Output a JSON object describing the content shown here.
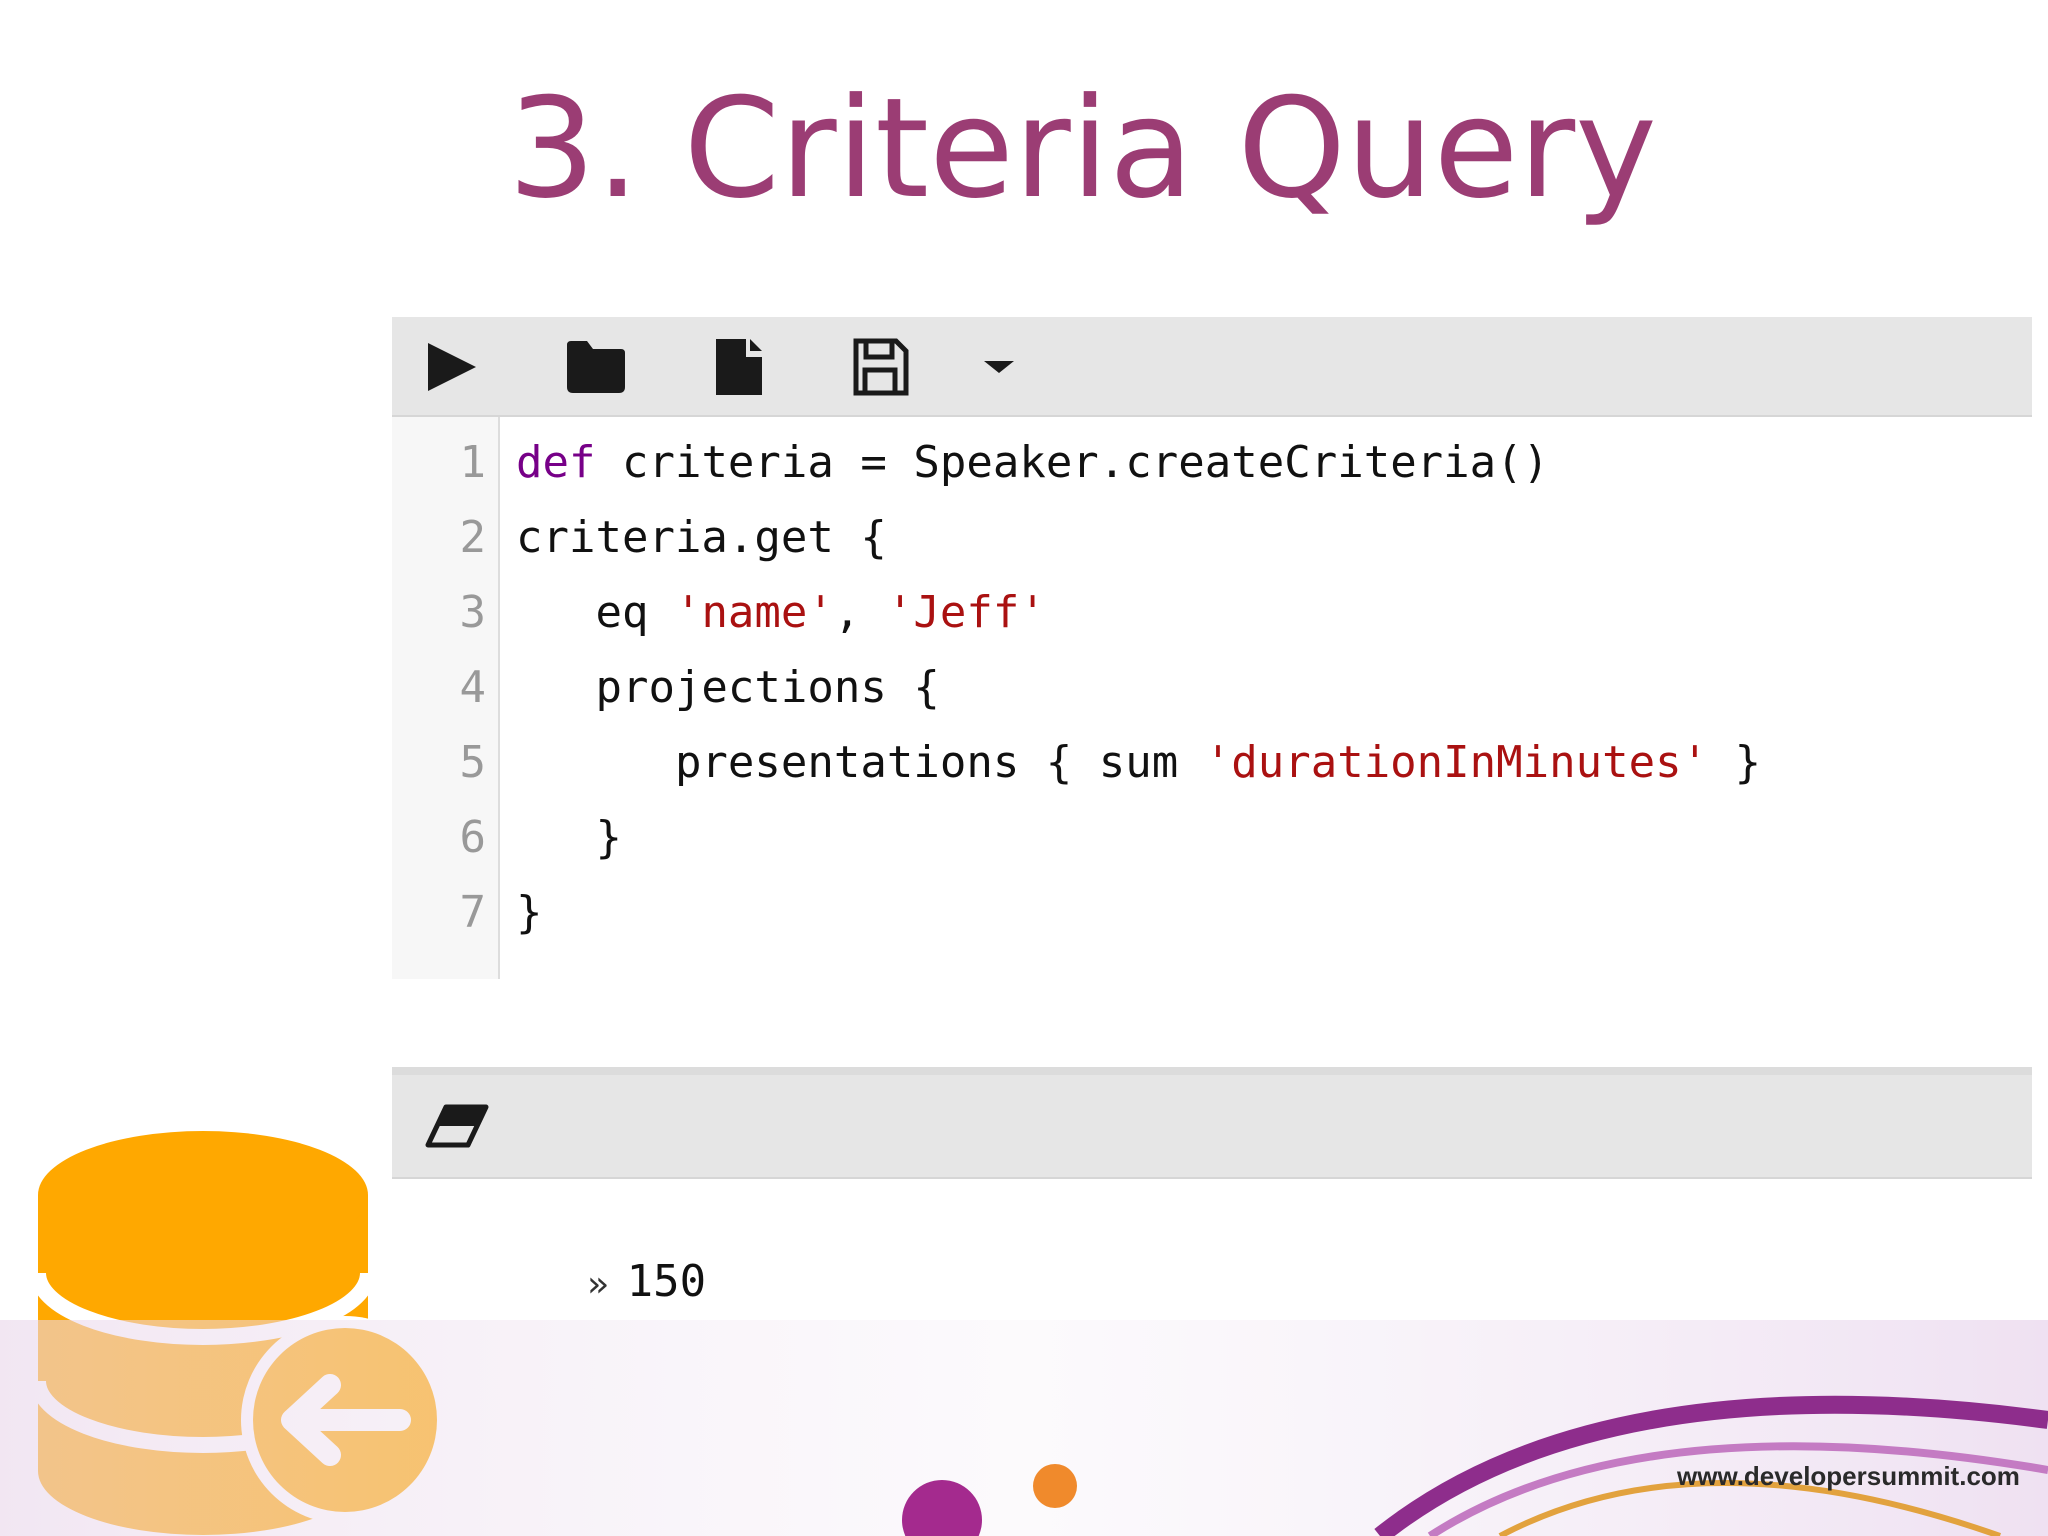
{
  "slide": {
    "title": "3. Criteria Query",
    "footer_url": "www.developersummit.com"
  },
  "toolbar": {
    "buttons": [
      {
        "name": "run-icon"
      },
      {
        "name": "folder-icon"
      },
      {
        "name": "file-icon"
      },
      {
        "name": "save-icon"
      },
      {
        "name": "dropdown-caret-icon"
      }
    ]
  },
  "editor": {
    "line_numbers": [
      "1",
      "2",
      "3",
      "4",
      "5",
      "6",
      "7"
    ],
    "lines": [
      [
        {
          "t": "def",
          "c": "kw"
        },
        {
          "t": " criteria = Speaker.createCriteria()",
          "c": ""
        }
      ],
      [
        {
          "t": "criteria.get {",
          "c": ""
        }
      ],
      [
        {
          "t": "   eq ",
          "c": ""
        },
        {
          "t": "'name'",
          "c": "str"
        },
        {
          "t": ", ",
          "c": ""
        },
        {
          "t": "'Jeff'",
          "c": "str"
        }
      ],
      [
        {
          "t": "   projections {",
          "c": ""
        }
      ],
      [
        {
          "t": "      presentations { sum ",
          "c": ""
        },
        {
          "t": "'durationInMinutes'",
          "c": "str"
        },
        {
          "t": " }",
          "c": ""
        }
      ],
      [
        {
          "t": "   }",
          "c": ""
        }
      ],
      [
        {
          "t": "}",
          "c": ""
        }
      ]
    ]
  },
  "output": {
    "clear_icon": "eraser-icon",
    "prompt": "»",
    "result": "150"
  },
  "colors": {
    "title": "#9b3d74",
    "keyword": "#770088",
    "string": "#aa1111",
    "db_icon": "#ffa800"
  }
}
